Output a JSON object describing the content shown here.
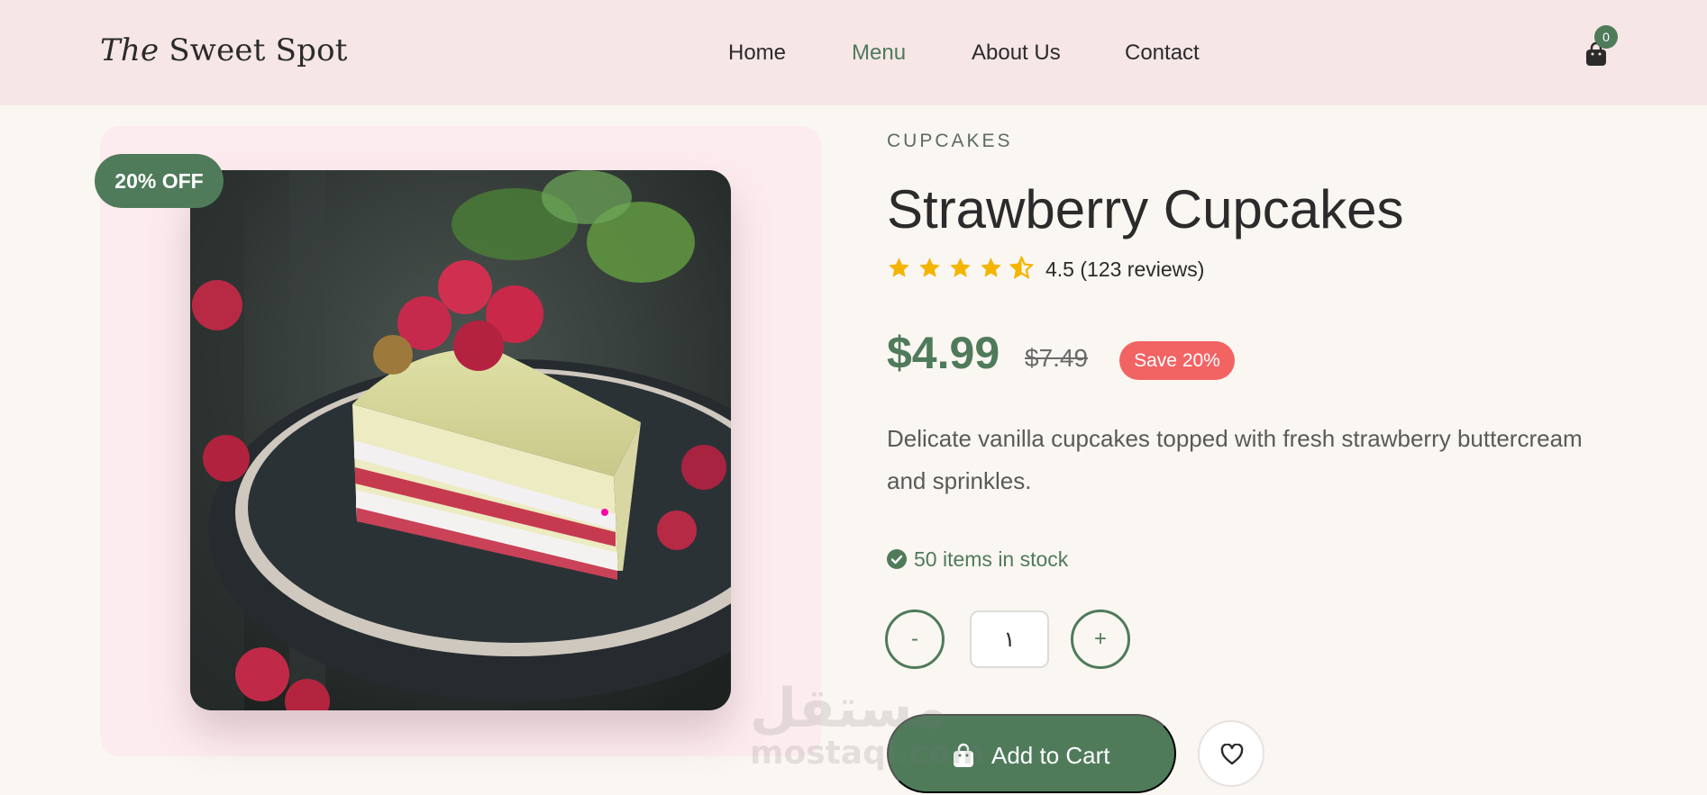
{
  "header": {
    "logo_italic": "The",
    "logo_rest": "Sweet Spot",
    "nav": [
      {
        "label": "Home",
        "active": false
      },
      {
        "label": "Menu",
        "active": true
      },
      {
        "label": "About Us",
        "active": false
      },
      {
        "label": "Contact",
        "active": false
      }
    ],
    "cart_icon": "shopping-bag-icon",
    "cart_count": "0"
  },
  "product": {
    "discount_badge": "20% OFF",
    "image_alt": "Slice of layered cake topped with raspberries on a dark plate",
    "category": "CUPCAKES",
    "title": "Strawberry Cupcakes",
    "rating": 4.5,
    "rating_text": "4.5 (123 reviews)",
    "price": "$4.99",
    "old_price": "$7.49",
    "save_badge": "Save 20%",
    "description": "Delicate vanilla cupcakes topped with fresh strawberry buttercream and sprinkles.",
    "stock_text": "50 items in stock",
    "stock_icon": "check-circle-icon",
    "quantity": {
      "decrement_label": "-",
      "value": "١",
      "increment_label": "+"
    },
    "add_to_cart_label": "Add to Cart",
    "add_to_cart_icon": "shopping-bag-icon",
    "wishlist_icon": "heart-icon"
  },
  "watermark": {
    "arabic": "مستقل",
    "latin": "mostaql.com"
  },
  "colors": {
    "brand_green": "#4f7b5b",
    "header_bg": "#f6e6e6",
    "page_bg": "#faf6f1",
    "save_red": "#f26363",
    "star_gold": "#f4b400"
  }
}
